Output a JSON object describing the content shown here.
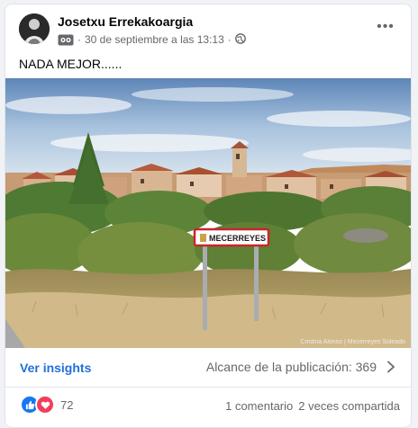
{
  "post": {
    "author": "Josetxu Errekakoargia",
    "date": "30 de septiembre a las 13:13",
    "audience_icon": "globe-icon",
    "text": "NADA MEJOR......",
    "more_icon": "more-options-icon",
    "more_label": "•••"
  },
  "photo": {
    "sign_text": "MECERREYES",
    "credit": "Cristina Alonso | Mecerreyes Soleado"
  },
  "insights": {
    "link_label": "Ver insights",
    "reach_label": "Alcance de la publicación: 369"
  },
  "footer": {
    "reaction_count": "72",
    "comments": "1 comentario",
    "shares": "2 veces compartida"
  },
  "colors": {
    "link": "#216fdb",
    "like": "#1877f2",
    "love": "#f33e58"
  }
}
